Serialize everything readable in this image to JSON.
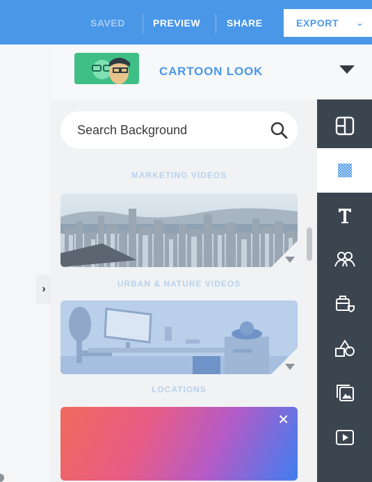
{
  "topbar": {
    "saved_label": "SAVED",
    "preview_label": "PREVIEW",
    "share_label": "SHARE",
    "export_label": "EXPORT",
    "bar_color": "#4a97e8"
  },
  "style_selector": {
    "title": "CARTOON LOOK",
    "thumb_color": "#3fbf86"
  },
  "search": {
    "placeholder": "Search Background"
  },
  "sections": [
    {
      "title": "MARKETING VIDEOS"
    },
    {
      "title": "URBAN & NATURE VIDEOS"
    },
    {
      "title": "LOCATIONS"
    }
  ],
  "toolbar": {
    "items": [
      {
        "icon": "layout-icon"
      },
      {
        "icon": "background-pattern-icon",
        "active": true
      },
      {
        "icon": "text-icon"
      },
      {
        "icon": "characters-icon"
      },
      {
        "icon": "props-icon"
      },
      {
        "icon": "shapes-icon"
      },
      {
        "icon": "media-icon"
      },
      {
        "icon": "video-icon"
      }
    ],
    "accent": "#4a97e8",
    "background": "#3b4550"
  }
}
